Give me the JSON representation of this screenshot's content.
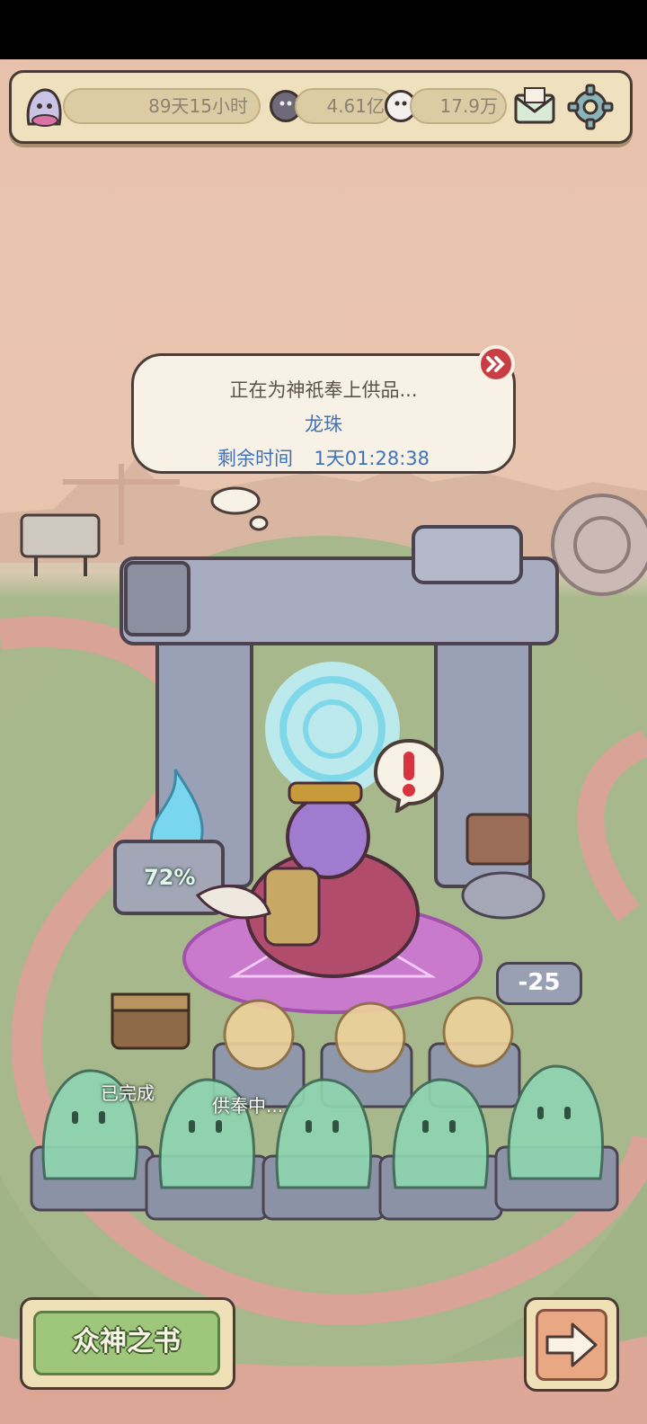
{
  "top_bar": {
    "player_time": "89天15小时",
    "currency_1": "4.61亿",
    "currency_2": "17.9万"
  },
  "offering": {
    "status_text": "正在为神祇奉上供品...",
    "item_name": "龙珠",
    "remaining_label": "剩余时间",
    "remaining_value": "1天01:28:38"
  },
  "progress": {
    "percent_label": "72%"
  },
  "damage_popup": "-25",
  "slot_labels": {
    "completed": "已完成",
    "offering": "供奉中..."
  },
  "buttons": {
    "book_label": "众神之书"
  },
  "colors": {
    "bar_bg": "#efe1bd",
    "accent_text": "#3f72b8",
    "green_button": "#9fc77c",
    "portal_cyan": "#7fd8ea",
    "magic_circle": "#c84fd6",
    "ghost_green": "#8fd5b0"
  },
  "icons": {
    "avatar": "ghost-avatar-icon",
    "currency_1": "dark-soul-coin-icon",
    "currency_2": "white-soul-coin-icon",
    "mail": "mail-icon",
    "settings": "gear-icon",
    "skip": "fast-forward-icon",
    "alert": "exclamation-icon",
    "next": "right-arrow-icon"
  }
}
